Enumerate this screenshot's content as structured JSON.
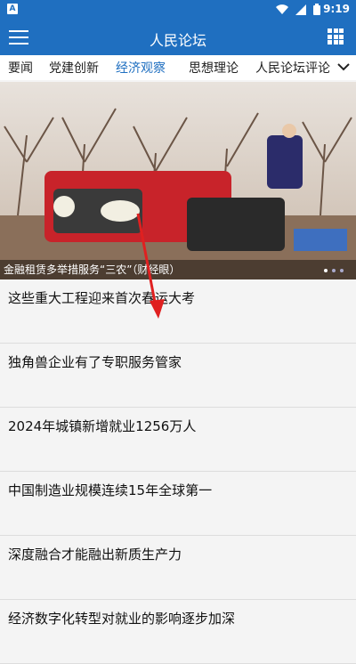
{
  "status": {
    "time": "9:19",
    "badge": "A"
  },
  "app": {
    "title": "人民论坛"
  },
  "tabs": [
    "要闻",
    "党建创新",
    "经济观察",
    "思想理论",
    "人民论坛评论"
  ],
  "active_tab": "经济观察",
  "banner": {
    "caption": "金融租赁多举措服务“三农”（财经眼）"
  },
  "articles": [
    {
      "title": "这些重大工程迎来首次春运大考"
    },
    {
      "title": "独角兽企业有了专职服务管家"
    },
    {
      "title": "2024年城镇新增就业1256万人"
    },
    {
      "title": "中国制造业规模连续15年全球第一"
    },
    {
      "title": "深度融合才能融出新质生产力"
    },
    {
      "title": "经济数字化转型对就业的影响逐步加深"
    }
  ],
  "colors": {
    "primary": "#1f6fc0",
    "annotation": "#e02020"
  }
}
